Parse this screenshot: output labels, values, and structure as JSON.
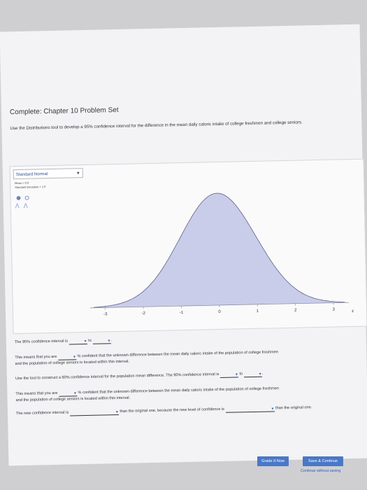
{
  "page": {
    "title": "Complete: Chapter 10 Problem Set",
    "instructions": "Use the Distributions tool to develop a 95% confidence interval for the difference in the mean daily caloric intake of college freshmen and college seniors."
  },
  "tool": {
    "distribution": "Standard Normal",
    "mean_label": "Mean = 0.0",
    "sd_label": "Standard Deviation = 1.0"
  },
  "chart_data": {
    "type": "area",
    "x_ticks": [
      "-3",
      "-2",
      "-1",
      "0",
      "1",
      "2",
      "3"
    ],
    "x_axis_label": "z",
    "xlim": [
      -3.4,
      3.4
    ],
    "fill_color": "#c9cde9",
    "line_color": "#5c5f8a"
  },
  "questions": {
    "q1_pre": "The 95% confidence interval is",
    "q1_to": "to",
    "q2_a": "This means that you are",
    "q2_b": "% confident that the unknown difference between the mean daily caloric intake of the population of college freshmen",
    "q2_c": "and the population of college seniors is located within this interval.",
    "q3": "Use the tool to construct a 90% confidence interval for the population mean difference. The 90% confidence interval is",
    "q3_to": "to",
    "q4_a": "This means that you are",
    "q4_b": "% confident that the unknown difference between the mean daily caloric intake of the population of college freshmen",
    "q4_c": "and the population of college seniors is located within this interval.",
    "q5_a": "The new confidence interval is",
    "q5_b": "than the original one, because the new level of confidence is",
    "q5_c": "than the original one."
  },
  "buttons": {
    "grade": "Grade It Now",
    "save": "Save & Continue",
    "continue_link": "Continue without saving"
  }
}
